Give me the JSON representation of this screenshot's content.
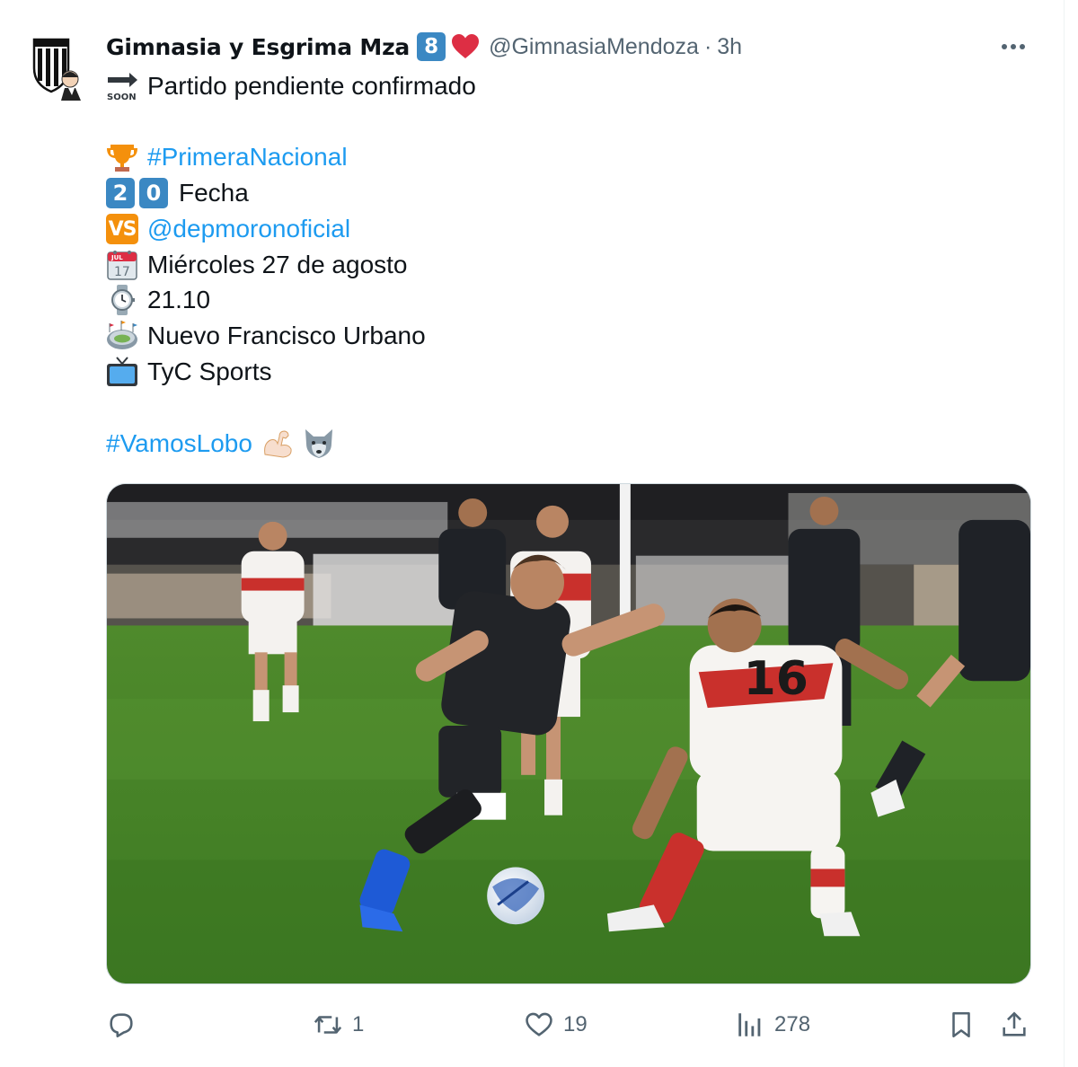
{
  "author": {
    "display_name": "Gimnasia y Esgrima Mza",
    "badge": "8",
    "handle": "@GimnasiaMendoza",
    "separator": "·",
    "time": "3h",
    "avatar_icon": "club-crest-avatar"
  },
  "tweet": {
    "line1": "Partido pendiente confirmado",
    "line1_icon_label": "SOON",
    "hashtag_primera": "#PrimeraNacional",
    "fecha_digits": [
      "2",
      "0"
    ],
    "fecha_label": "Fecha",
    "vs_label": "VS",
    "opponent_mention": "@depmoronoficial",
    "date_text": "Miércoles 27 de agosto",
    "calendar_day": "17",
    "calendar_month": "JUL",
    "time_text": "21.10",
    "venue_text": "Nuevo Francisco Urbano",
    "tv_text": "TyC Sports",
    "hashtag_vamos": "#VamosLobo"
  },
  "media": {
    "player_number": "16"
  },
  "actions": {
    "reply_count": "",
    "retweet_count": "1",
    "like_count": "19",
    "views_count": "278"
  },
  "colors": {
    "link": "#1d9bf0",
    "muted": "#536471",
    "keycap": "#3b88c3",
    "vs": "#f4900c",
    "heart": "#dd2e44"
  }
}
